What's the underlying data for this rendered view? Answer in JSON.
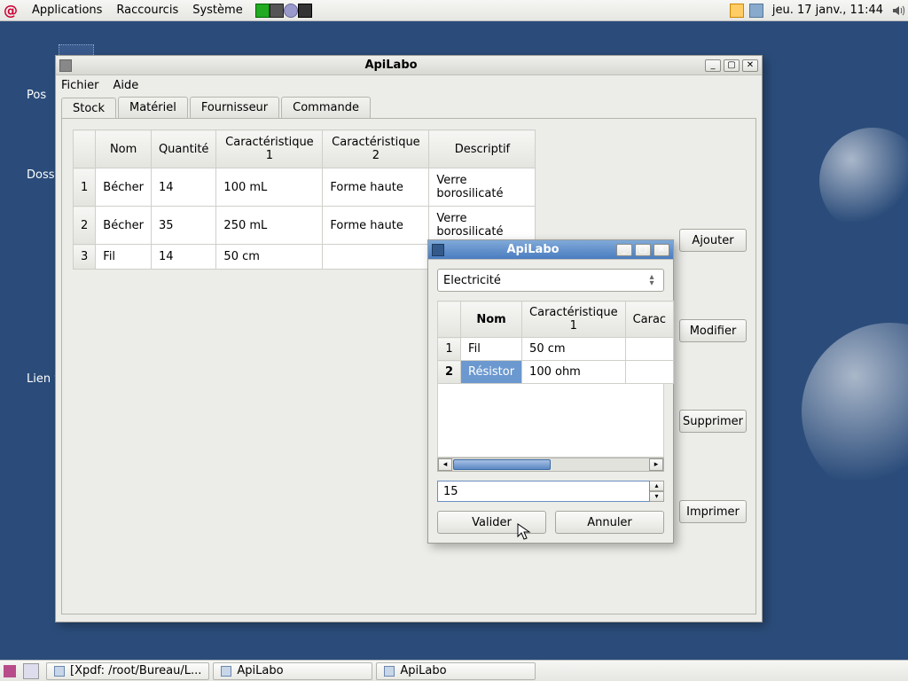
{
  "panel": {
    "menus": [
      "Applications",
      "Raccourcis",
      "Système"
    ],
    "clock": "jeu. 17 janv., 11:44"
  },
  "desktop": {
    "icon_labels": [
      "Pos",
      "Doss",
      "Lien ve"
    ]
  },
  "main_window": {
    "title": "ApiLabo",
    "menubar": [
      "Fichier",
      "Aide"
    ],
    "tabs": [
      "Stock",
      "Matériel",
      "Fournisseur",
      "Commande"
    ],
    "active_tab": 0,
    "columns": [
      "",
      "Nom",
      "Quantité",
      "Caractéristique 1",
      "Caractéristique 2",
      "Descriptif"
    ],
    "rows": [
      {
        "n": "1",
        "nom": "Bécher",
        "qte": "14",
        "c1": "100 mL",
        "c2": "Forme haute",
        "desc": "Verre borosilicaté"
      },
      {
        "n": "2",
        "nom": "Bécher",
        "qte": "35",
        "c1": "250 mL",
        "c2": "Forme haute",
        "desc": "Verre borosilicaté"
      },
      {
        "n": "3",
        "nom": "Fil",
        "qte": "14",
        "c1": "50 cm",
        "c2": "",
        "desc": ""
      }
    ],
    "buttons": {
      "add": "Ajouter",
      "edit": "Modifier",
      "del": "Supprimer",
      "print": "Imprimer"
    }
  },
  "dialog": {
    "title": "ApiLabo",
    "category": "Electricité",
    "columns": [
      "",
      "Nom",
      "Caractéristique 1",
      "Carac"
    ],
    "rows": [
      {
        "n": "1",
        "nom": "Fil",
        "c1": "50 cm"
      },
      {
        "n": "2",
        "nom": "Résistor",
        "c1": "100 ohm"
      }
    ],
    "selected_row_index": 1,
    "qty_value": "15",
    "buttons": {
      "ok": "Valider",
      "cancel": "Annuler"
    }
  },
  "taskbar": {
    "items": [
      "[Xpdf: /root/Bureau/L...",
      "ApiLabo",
      "ApiLabo"
    ]
  }
}
